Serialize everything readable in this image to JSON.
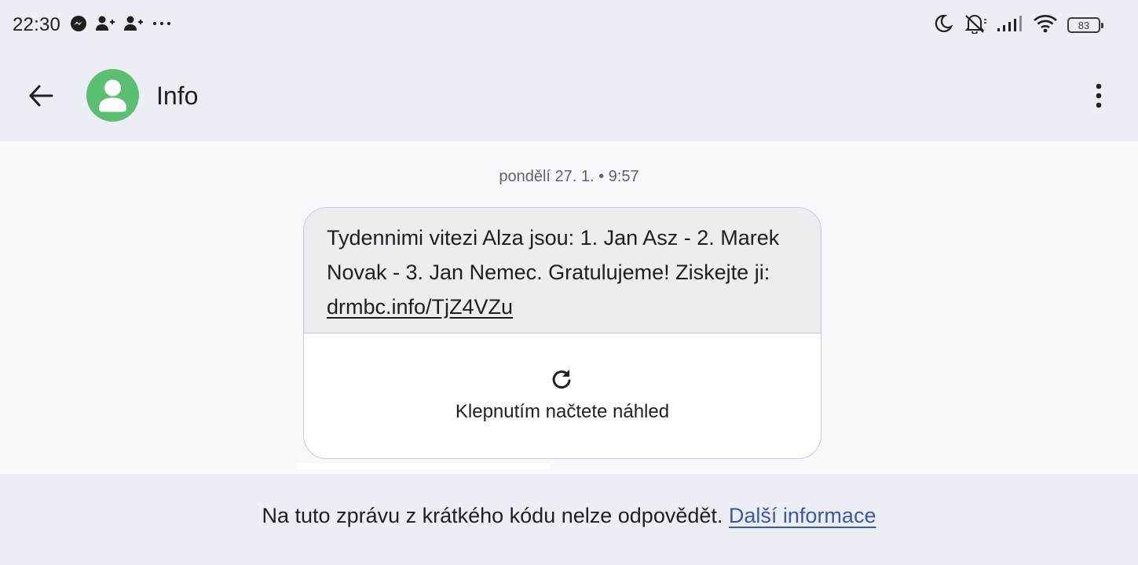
{
  "status_bar": {
    "time": "22:30",
    "left_icons": [
      "messenger-icon",
      "person-add-icon",
      "person-add-icon",
      "more-dots-icon"
    ],
    "right_icons": [
      "moon-icon",
      "bell-off-icon",
      "signal-icon",
      "wifi-icon"
    ],
    "battery_level": "83"
  },
  "app_bar": {
    "contact_name": "Info",
    "avatar_color": "#5bbf72"
  },
  "conversation": {
    "timestamp": "pondělí 27. 1. • 9:57",
    "message": {
      "text": "Tydennimi vitezi Alza jsou: 1.  Jan Asz - 2. Marek Novak - 3. Jan Nemec. Gratulujeme! Ziskejte ji: ",
      "link": "drmbc.info/TjZ4VZu"
    },
    "preview_label": "Klepnutím načtete náhled"
  },
  "footer": {
    "notice": "Na tuto zprávu z krátkého kódu nelze odpovědět. ",
    "link": "Další informace",
    "link_color": "#3c5a9e"
  }
}
